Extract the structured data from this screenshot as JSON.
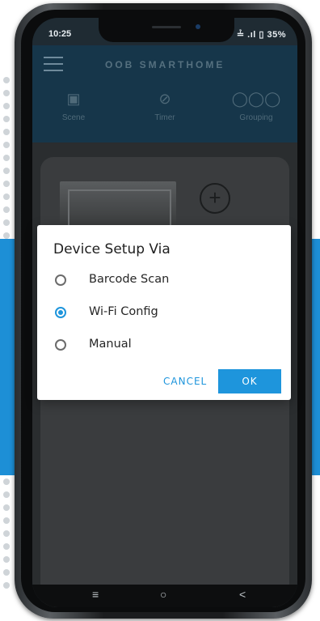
{
  "status_bar": {
    "time": "10:25",
    "indicators": "≟ .ıl ▯ 35%"
  },
  "app_bar": {
    "title": "OOB SMARTHOME",
    "menu_icon": "hamburger-menu-icon"
  },
  "tabs": [
    {
      "label": "Scene",
      "icon": "scene-icon"
    },
    {
      "label": "Timer",
      "icon": "timer-icon"
    },
    {
      "label": "Grouping",
      "icon": "grouping-icon"
    }
  ],
  "dialog": {
    "title": "Device Setup Via",
    "options": [
      {
        "label": "Barcode Scan",
        "selected": false
      },
      {
        "label": "Wi-Fi Config",
        "selected": true
      },
      {
        "label": "Manual",
        "selected": false
      }
    ],
    "cancel_label": "CANCEL",
    "ok_label": "OK"
  },
  "nav_bar": {
    "menu_glyph": "≡",
    "home_glyph": "○",
    "back_glyph": "<"
  },
  "colors": {
    "accent": "#1e95dc",
    "app_bar": "#16364a",
    "side_strip": "#1d8fd6"
  }
}
